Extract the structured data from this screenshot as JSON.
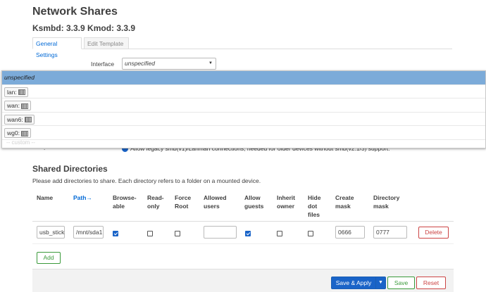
{
  "page": {
    "title": "Network Shares",
    "version": "Ksmbd: 3.3.9 Kmod: 3.3.9"
  },
  "tabs": [
    {
      "label": "General Settings",
      "active": true
    },
    {
      "label": "Edit Template",
      "active": false
    }
  ],
  "interface": {
    "label": "Interface",
    "value": "unspecified",
    "dropdown": {
      "selected": "unspecified",
      "options": [
        {
          "label": "lan:",
          "icon": "network-interface-icon"
        },
        {
          "label": "wan:",
          "icon": "network-interface-icon"
        },
        {
          "label": "wan6:",
          "icon": "network-interface-icon"
        },
        {
          "label": "wg0:",
          "icon": "vpn-interface-icon"
        }
      ],
      "custom_placeholder": "-- custom --"
    }
  },
  "legacy": {
    "text": "Allow legacy smb(v1)/Lanman connections, needed for older devices without smb(v2.1/3) support."
  },
  "shared": {
    "title": "Shared Directories",
    "description": "Please add directories to share. Each directory refers to a folder on a mounted device.",
    "columns": [
      {
        "label": "Name"
      },
      {
        "label": "Path→"
      },
      {
        "label": "Browse-\nable"
      },
      {
        "label": "Read-\nonly"
      },
      {
        "label": "Force\nRoot"
      },
      {
        "label": "Allowed\nusers"
      },
      {
        "label": "Allow\nguests"
      },
      {
        "label": "Inherit\nowner"
      },
      {
        "label": "Hide\ndot\nfiles"
      },
      {
        "label": "Create\nmask"
      },
      {
        "label": "Directory\nmask"
      }
    ],
    "rows": [
      {
        "name": "usb_stick",
        "path": "/mnt/sda1",
        "browseable": true,
        "read_only": false,
        "force_root": false,
        "allowed_users": "",
        "allow_guests": true,
        "inherit_owner": false,
        "hide_dot_files": false,
        "create_mask": "0666",
        "directory_mask": "0777",
        "delete_label": "Delete"
      }
    ],
    "add_label": "Add"
  },
  "footer": {
    "save_apply_label": "Save & Apply",
    "save_label": "Save",
    "reset_label": "Reset"
  },
  "colors": {
    "accent": "#1a64c8",
    "link": "#0069d6",
    "danger": "#cc4444",
    "success": "#3a9a3a",
    "dropdown_selected": "#7cabd9"
  }
}
